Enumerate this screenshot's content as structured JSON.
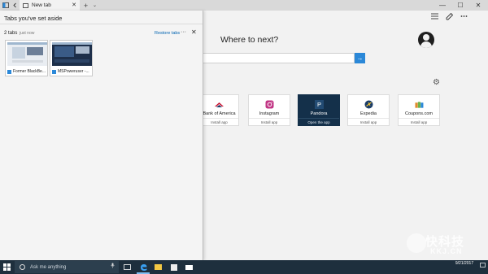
{
  "browser": {
    "active_tab": {
      "title": "New tab",
      "close_glyph": "✕"
    },
    "new_tab_glyph": "+",
    "tab_list_glyph": "⌄",
    "window_controls": {
      "minimize": "—",
      "maximize": "☐",
      "close": "✕"
    }
  },
  "toolbar": {
    "icons": [
      "hub-icon",
      "notes-icon",
      "more-icon"
    ]
  },
  "new_tab_page": {
    "heading": "Where to next?",
    "search": {
      "value": "",
      "go_glyph": "→"
    },
    "gear_glyph": "⚙",
    "tiles": [
      {
        "name": "Bank of America",
        "action": "Install app",
        "icon": "bank-of-america-icon",
        "accent": "#c8102e"
      },
      {
        "name": "Instagram",
        "action": "Install app",
        "icon": "instagram-icon",
        "accent": "#c13584"
      },
      {
        "name": "Pandora",
        "action": "Open the app",
        "icon": "pandora-icon",
        "accent": "#224b73",
        "glyph": "P"
      },
      {
        "name": "Expedia",
        "action": "Install app",
        "icon": "expedia-icon",
        "accent": "#1a3c68"
      },
      {
        "name": "Coupons.com",
        "action": "Install app",
        "icon": "coupons-icon",
        "accent": "#e08a2c"
      }
    ]
  },
  "tabs_aside": {
    "title": "Tabs you've set aside",
    "group": {
      "count_label": "2 tabs",
      "time_label": "just now",
      "restore_label": "Restore tabs",
      "more_glyph": "···",
      "close_glyph": "✕",
      "tabs": [
        {
          "caption": "Former BlackBe..."
        },
        {
          "caption": "MSPoweruser -..."
        }
      ]
    }
  },
  "taskbar": {
    "search_placeholder": "Ask me anything",
    "mic_glyph": "🎤",
    "clock": {
      "time": "",
      "date": "9/21/2017"
    },
    "notify_glyph": "▭"
  },
  "watermark": {
    "main": "快科技",
    "sub": "KKJ.CN"
  },
  "colors": {
    "accent_blue": "#2b88d8",
    "taskbar_bg": "#1e2f3d",
    "pandora_tile": "#14304a",
    "link_blue": "#0063b1"
  }
}
